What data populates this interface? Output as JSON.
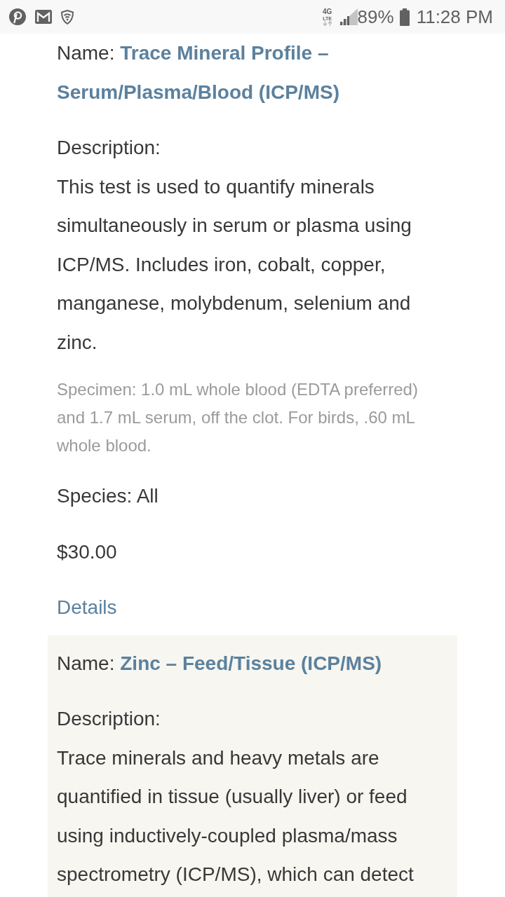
{
  "status_bar": {
    "network_type": "4G",
    "network_subtype": "LTE",
    "battery": "89%",
    "time": "11:28 PM"
  },
  "tests": [
    {
      "name": "Name: **Trace Mineral Profile – Serum/Plasma/Blood (ICP/MS)**",
      "description_label": "Description:",
      "description": "This test is used to quantify minerals simultaneously in serum or plasma using ICP/MS. Includes iron, cobalt, copper, manganese, molybdenum, selenium and zinc.",
      "specimen": "Specimen: 1.0 mL whole blood (EDTA preferred) and 1.7 mL serum, off the clot. For birds, .60 mL whole blood.",
      "species": "Species: All",
      "price": "$30.00",
      "details_link": "Details"
    },
    {
      "name": "Name: **Zinc – Feed/Tissue (ICP/MS)**",
      "description_label": "Description:",
      "description": "Trace minerals and heavy metals are quantified in tissue (usually liver) or feed using inductively-coupled plasma/mass spectrometry (ICP/MS), which can detect"
    }
  ]
}
